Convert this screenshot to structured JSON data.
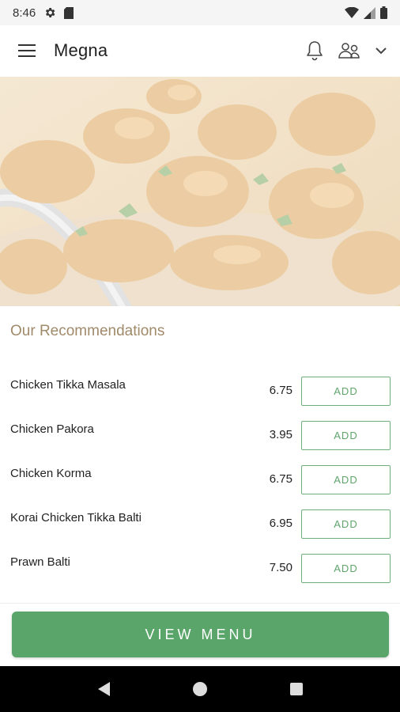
{
  "status_bar": {
    "time": "8:46",
    "icons": [
      "settings-icon",
      "sim-card-icon",
      "wifi-icon",
      "signal-icon",
      "battery-icon"
    ]
  },
  "app_bar": {
    "title": "Megna",
    "icons": [
      "menu-icon",
      "bell-icon",
      "user-group-icon",
      "chevron-down-icon"
    ]
  },
  "hero": {
    "image": "chicken-curry-photo"
  },
  "recommendations": {
    "title": "Our Recommendations",
    "items": [
      {
        "name": "Chicken Tikka Masala",
        "price": "6.75",
        "button": "ADD"
      },
      {
        "name": "Chicken Pakora",
        "price": "3.95",
        "button": "ADD"
      },
      {
        "name": "Chicken Korma",
        "price": "6.75",
        "button": "ADD"
      },
      {
        "name": "Korai Chicken Tikka Balti",
        "price": "6.95",
        "button": "ADD"
      },
      {
        "name": "Prawn Balti",
        "price": "7.50",
        "button": "ADD"
      }
    ]
  },
  "view_menu": {
    "label": "VIEW MENU"
  },
  "nav_bar": {
    "icons": [
      "back-icon",
      "home-icon",
      "recents-icon"
    ]
  },
  "colors": {
    "accent_green": "#5aa56a",
    "section_title": "#a08a6a",
    "add_border": "#6fae7a"
  }
}
